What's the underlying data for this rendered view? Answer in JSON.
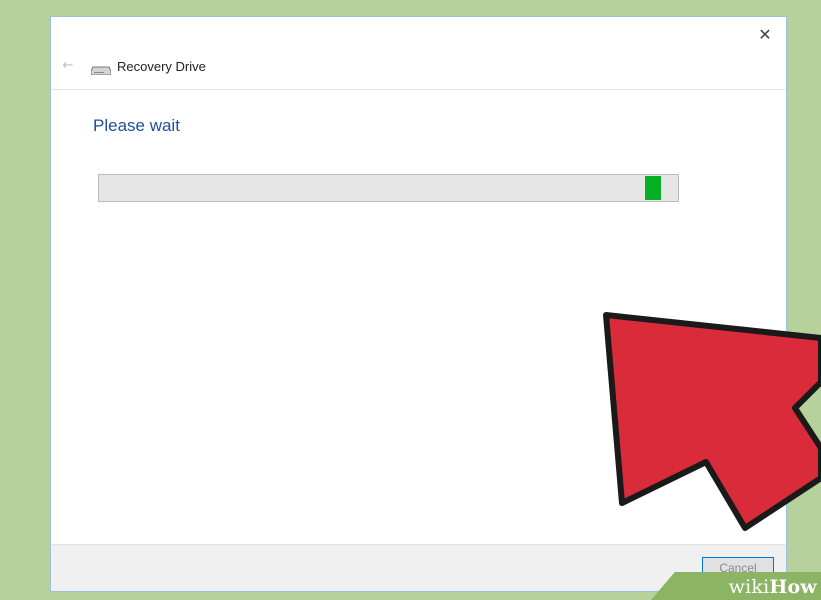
{
  "window": {
    "title": "Recovery Drive",
    "close_glyph": "✕",
    "back_glyph": "←"
  },
  "main": {
    "heading": "Please wait",
    "progress_color": "#06b025",
    "progress_fraction": 0.97
  },
  "footer": {
    "cancel_label": "Cancel"
  },
  "overlay": {
    "arrow_color": "#d92b3a",
    "watermark_prefix": "wiki",
    "watermark_suffix": "How"
  },
  "icons": [
    "back-arrow-icon",
    "drive-icon",
    "close-icon"
  ]
}
